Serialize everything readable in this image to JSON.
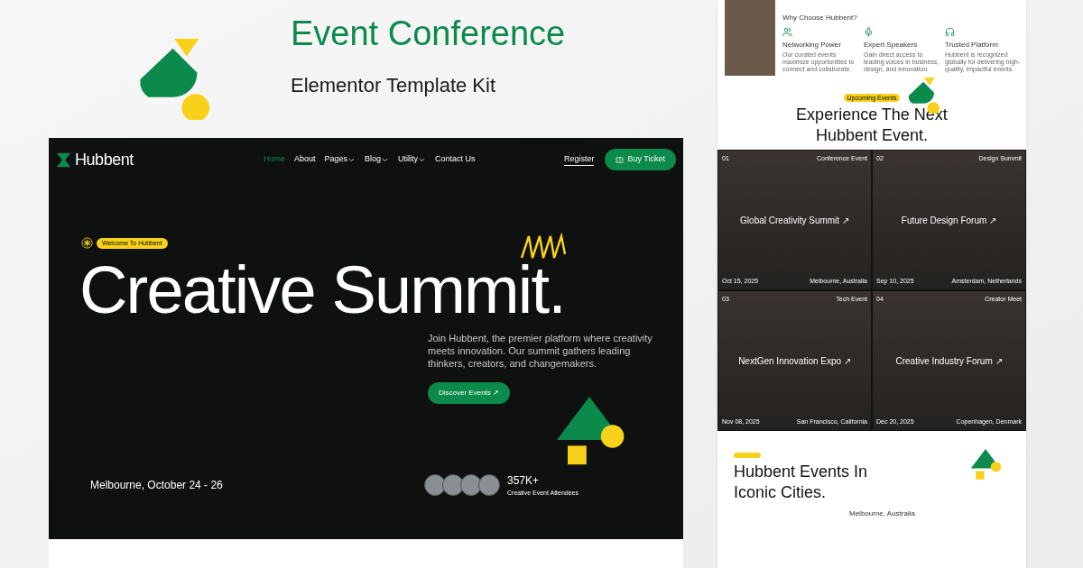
{
  "heading": {
    "line": "Event Conference",
    "subtitle": "Elementor Template Kit"
  },
  "site": {
    "logo": "Hubbent",
    "nav": [
      {
        "label": "Home",
        "selected": true,
        "dropdown": false
      },
      {
        "label": "About",
        "selected": false,
        "dropdown": false
      },
      {
        "label": "Pages",
        "selected": false,
        "dropdown": true
      },
      {
        "label": "Blog",
        "selected": false,
        "dropdown": true
      },
      {
        "label": "Utility",
        "selected": false,
        "dropdown": true
      },
      {
        "label": "Contact Us",
        "selected": false,
        "dropdown": false
      }
    ],
    "register": "Register",
    "buy": "Buy Ticket",
    "badge": "Welcome To Hubbent",
    "hero_title": "Creative Summit.",
    "intro": "Join Hubbent, the premier platform where creativity meets innovation. Our summit gathers leading thinkers, creators, and changemakers.",
    "cta": "Discover Events ↗",
    "date": "Melbourne, October 24 - 26",
    "count": "357K+",
    "count_label": "Creative Event Attendees"
  },
  "preview": {
    "why_title": "Why Choose Hubbent?",
    "features": [
      {
        "title": "Networking Power",
        "text": "Our curated events maximize opportunities to connect and collaborate."
      },
      {
        "title": "Expert Speakers",
        "text": "Gain direct access to leading voices in business, design, and innovation."
      },
      {
        "title": "Trusted Platform",
        "text": "Hubbent is recognized globally for delivering high-quality, impactful events."
      }
    ],
    "upcoming_badge": "Upcoming Events",
    "upcoming_title": "Experience The Next Hubbent Event.",
    "events": [
      {
        "number": "01",
        "type": "Conference Event",
        "title": "Global Creativity Summit ↗",
        "date": "Oct 15, 2025",
        "place": "Melbourne, Australia"
      },
      {
        "number": "02",
        "type": "Design Summit",
        "title": "Future Design Forum ↗",
        "date": "Sep 10, 2025",
        "place": "Amsterdam, Netherlands"
      },
      {
        "number": "03",
        "type": "Tech Event",
        "title": "NextGen Innovation Expo ↗",
        "date": "Nov 08, 2025",
        "place": "San Francisco, California"
      },
      {
        "number": "04",
        "type": "Creator Meet",
        "title": "Creative Industry Forum ↗",
        "date": "Dec 20, 2025",
        "place": "Copenhagen, Denmark"
      }
    ],
    "cities_title": "Hubbent Events In Iconic Cities.",
    "city": "Melbourne, Australia"
  }
}
